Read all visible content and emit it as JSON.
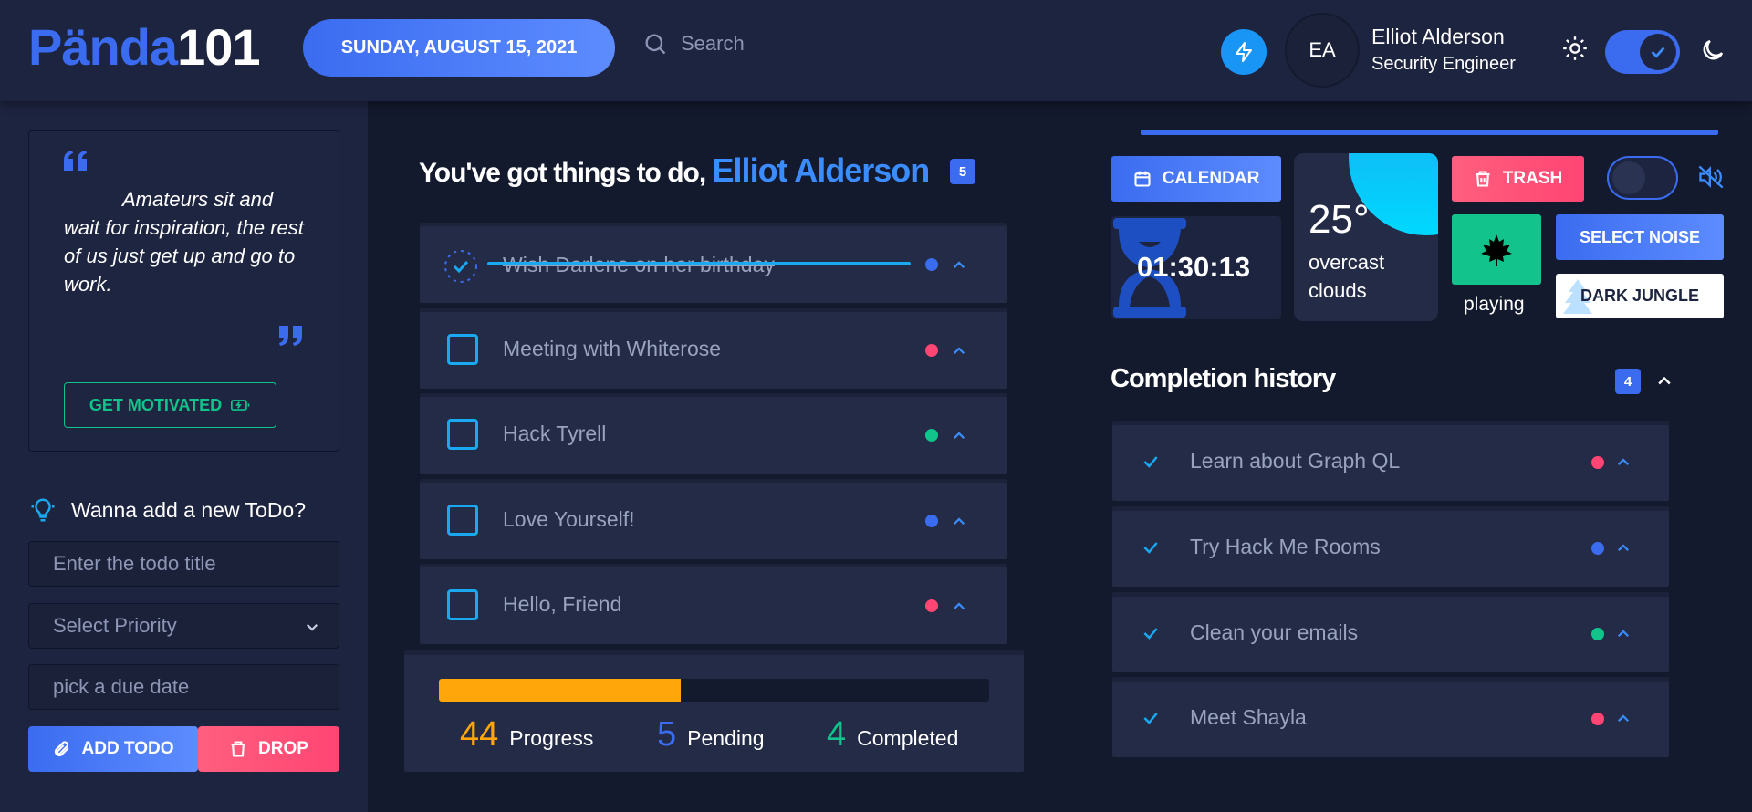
{
  "header": {
    "logo_part1": "Pända",
    "logo_part2": "101",
    "date": "SUNDAY, AUGUST 15, 2021",
    "search_placeholder": "Search",
    "avatar_initials": "EA",
    "user_name": "Elliot Alderson",
    "user_role": "Security Engineer",
    "dark_mode_on": true
  },
  "sidebar": {
    "quote": "Amateurs sit and wait for inspiration, the rest of us just get up and go to work.",
    "motivate_label": "GET MOTIVATED",
    "add_title": "Wanna add a new ToDo?",
    "title_placeholder": "Enter the todo title",
    "priority_placeholder": "Select Priority",
    "date_placeholder": "pick a due date",
    "add_label": "ADD TODO",
    "drop_label": "DROP"
  },
  "todos": {
    "greeting": "You've got things to do,",
    "name": "Elliot Alderson",
    "count": "5",
    "items": [
      {
        "title": "Wish Darlene on her birthday",
        "done": true,
        "priority_color": "#3b6cf0"
      },
      {
        "title": "Meeting with Whiterose",
        "done": false,
        "priority_color": "#ff4573"
      },
      {
        "title": "Hack Tyrell",
        "done": false,
        "priority_color": "#12c48b"
      },
      {
        "title": "Love Yourself!",
        "done": false,
        "priority_color": "#3b6cf0"
      },
      {
        "title": "Hello, Friend",
        "done": false,
        "priority_color": "#ff4573"
      }
    ]
  },
  "stats": {
    "progress_value": "44",
    "progress_label": "Progress",
    "progress_fraction": 0.44,
    "pending_value": "5",
    "pending_label": "Pending",
    "completed_value": "4",
    "completed_label": "Completed"
  },
  "widgets": {
    "calendar_label": "CALENDAR",
    "timer": "01:30:13",
    "temperature": "25°",
    "condition": "overcast clouds",
    "trash_label": "TRASH",
    "playing_label": "playing",
    "select_noise_label": "SELECT NOISE",
    "noise_name": "DARK JUNGLE"
  },
  "history": {
    "title": "Completion history",
    "count": "4",
    "items": [
      {
        "title": "Learn about Graph QL",
        "priority_color": "#ff4573"
      },
      {
        "title": "Try Hack Me Rooms",
        "priority_color": "#3b6cf0"
      },
      {
        "title": "Clean your emails",
        "priority_color": "#12c48b"
      },
      {
        "title": "Meet Shayla",
        "priority_color": "#ff4573"
      }
    ]
  },
  "colors": {
    "accent": "#3b6cf0",
    "danger": "#ff4573",
    "success": "#12c48b",
    "warning": "#ffa60a",
    "cyan": "#1aa9f0"
  }
}
